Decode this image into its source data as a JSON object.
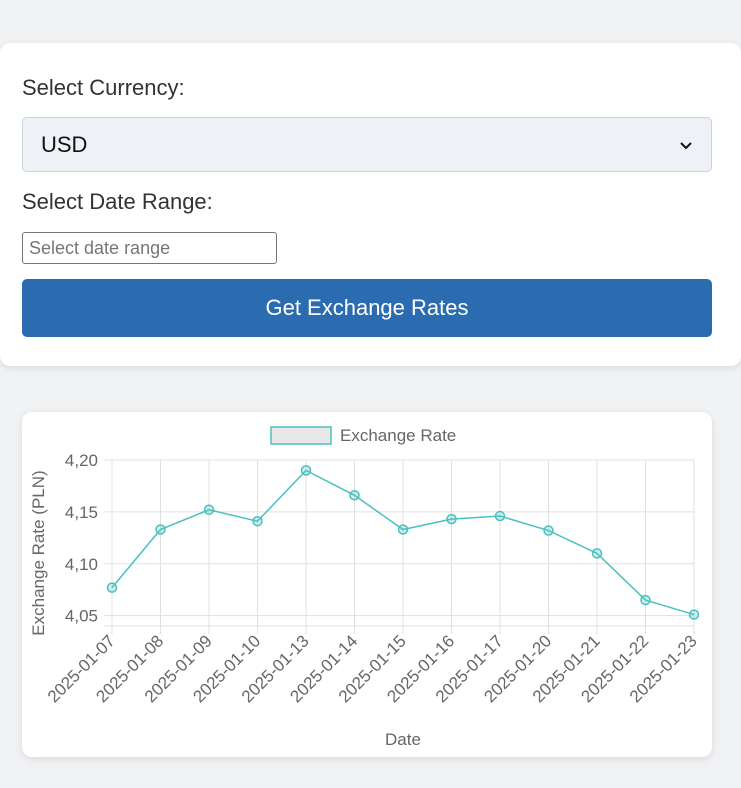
{
  "form": {
    "currency_label": "Select Currency:",
    "currency_value": "USD",
    "date_range_label": "Select Date Range:",
    "date_range_placeholder": "Select date range",
    "submit_label": "Get Exchange Rates"
  },
  "chart_data": {
    "type": "line",
    "categories": [
      "2025-01-07",
      "2025-01-08",
      "2025-01-09",
      "2025-01-10",
      "2025-01-13",
      "2025-01-14",
      "2025-01-15",
      "2025-01-16",
      "2025-01-17",
      "2025-01-20",
      "2025-01-21",
      "2025-01-22",
      "2025-01-23"
    ],
    "series": [
      {
        "name": "Exchange Rate",
        "values": [
          4.077,
          4.133,
          4.152,
          4.141,
          4.19,
          4.166,
          4.133,
          4.143,
          4.146,
          4.132,
          4.11,
          4.065,
          4.051
        ]
      }
    ],
    "xlabel": "Date",
    "ylabel": "Exchange Rate (PLN)",
    "ylim": [
      4.04,
      4.2
    ],
    "yticks": [
      4.05,
      4.1,
      4.15,
      4.2
    ],
    "ytick_labels": [
      "4,05",
      "4,10",
      "4,15",
      "4,20"
    ],
    "grid": true,
    "legend": "top",
    "line_color": "#4bc0c0",
    "fill_color": "#e8e8e8"
  }
}
